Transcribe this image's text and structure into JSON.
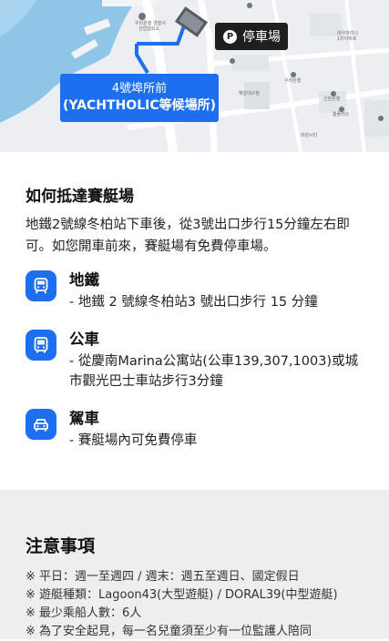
{
  "map": {
    "label_line1": "4號埠所前",
    "label_line2": "(YACHTHOLIC等候場所)",
    "parking_glyph": "P",
    "parking_label": "停車場",
    "tiny_labels": [
      "우리은행 경찰서",
      "산업협회소",
      "대우마리나",
      "1차아파트",
      "우리은행",
      "해운대구청",
      "신한은행",
      "홈플러스",
      "마린시티"
    ]
  },
  "directions": {
    "title": "如何抵達賽艇場",
    "description": "地鐵2號線冬柏站下車後，從3號出口步行15分鐘左右即可。如您開車前來，賽艇場有免費停車場。",
    "items": [
      {
        "icon": "subway-icon",
        "title": "地鐵",
        "text": "- 地鐵 2 號線冬柏站3 號出口步行 15 分鐘"
      },
      {
        "icon": "bus-icon",
        "title": "公車",
        "text": "- 從慶南Marina公寓站(公車139,307,1003)或城市觀光巴士車站步行3分鐘"
      },
      {
        "icon": "car-icon",
        "title": "駕車",
        "text": "- 賽艇場內可免費停車"
      }
    ]
  },
  "notice": {
    "title": "注意事項",
    "items": [
      "※ 平日：週一至週四 / 週末：週五至週日、國定假日",
      "※ 遊艇種類：Lagoon43(大型遊艇) / DORAL39(中型遊艇)",
      "※ 最少乘船人數：6人",
      "※ 為了安全起見，每一名兒童須至少有一位監護人陪同"
    ]
  },
  "colors": {
    "accent": "#1e6ff0",
    "dark_tag": "#1f1f1f",
    "notice_bg": "#eeeeee"
  }
}
